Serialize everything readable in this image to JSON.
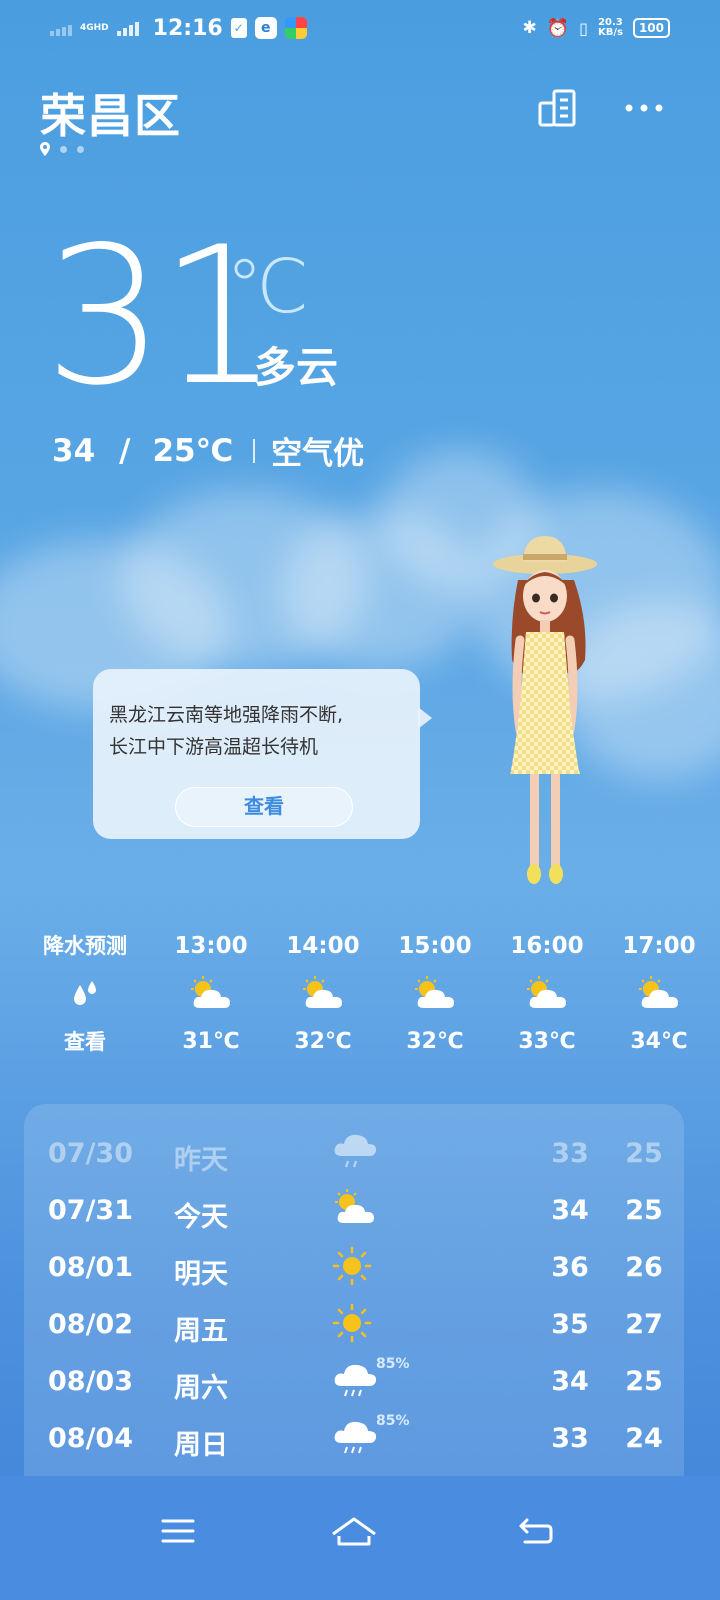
{
  "status_bar": {
    "time": "12:16",
    "network": "4GHD",
    "speed_value": "20.3",
    "speed_unit": "KB/s",
    "battery": "100"
  },
  "header": {
    "city": "荣昌区",
    "icons": [
      "location-icon",
      "building-icon",
      "more-icon"
    ]
  },
  "current": {
    "temperature": "31",
    "unit": "℃",
    "condition": "多云",
    "high": "34",
    "low_with_unit": "25℃",
    "slash": "/",
    "air_quality": "空气优"
  },
  "notice": {
    "text_line1": "黑龙江云南等地强降雨不断,",
    "text_line2": "长江中下游高温超长待机",
    "button_label": "查看"
  },
  "hourly": {
    "precip_label": "降水预测",
    "precip_button": "查看",
    "items": [
      {
        "time": "13:00",
        "icon": "partly-cloudy-icon",
        "temp": "31℃"
      },
      {
        "time": "14:00",
        "icon": "partly-cloudy-icon",
        "temp": "32℃"
      },
      {
        "time": "15:00",
        "icon": "partly-cloudy-icon",
        "temp": "32℃"
      },
      {
        "time": "16:00",
        "icon": "partly-cloudy-icon",
        "temp": "33℃"
      },
      {
        "time": "17:00",
        "icon": "partly-cloudy-icon",
        "temp": "34℃"
      }
    ]
  },
  "daily": [
    {
      "date": "07/30",
      "day": "昨天",
      "icon": "cloud-drizzle-icon",
      "precip": "",
      "high": "33",
      "low": "25",
      "past": true
    },
    {
      "date": "07/31",
      "day": "今天",
      "icon": "partly-cloudy-icon",
      "precip": "",
      "high": "34",
      "low": "25",
      "past": false
    },
    {
      "date": "08/01",
      "day": "明天",
      "icon": "sun-icon",
      "precip": "",
      "high": "36",
      "low": "26",
      "past": false
    },
    {
      "date": "08/02",
      "day": "周五",
      "icon": "sun-icon",
      "precip": "",
      "high": "35",
      "low": "27",
      "past": false
    },
    {
      "date": "08/03",
      "day": "周六",
      "icon": "rain-icon",
      "precip": "85%",
      "high": "34",
      "low": "25",
      "past": false
    },
    {
      "date": "08/04",
      "day": "周日",
      "icon": "rain-icon",
      "precip": "85%",
      "high": "33",
      "low": "24",
      "past": false
    }
  ],
  "colors": {
    "accent_button_text": "#3e8be0",
    "sun": "#f6c21c",
    "bubble_bg": "#e8f2fc"
  }
}
